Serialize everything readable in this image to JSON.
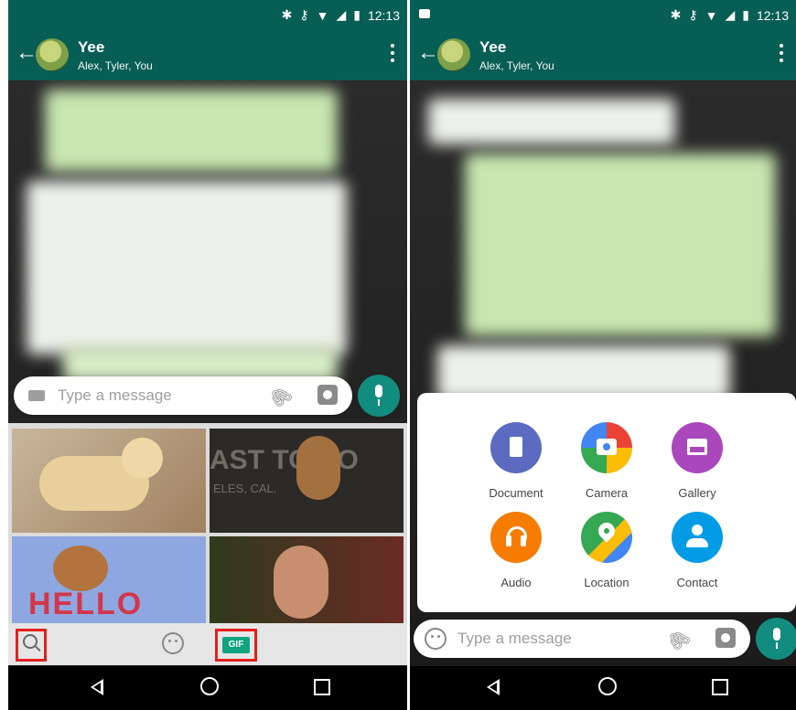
{
  "left": {
    "status": {
      "time": "12:13"
    },
    "header": {
      "title": "Yee",
      "subtitle": "Alex, Tyler, You"
    },
    "input": {
      "placeholder": "Type a message"
    },
    "gif_panel": {
      "gif_badge": "GIF",
      "hello_text": "HELLO",
      "coast_text": "AST TO CO",
      "city_text": "ELES, CAL."
    }
  },
  "right": {
    "status": {
      "time": "12:13"
    },
    "header": {
      "title": "Yee",
      "subtitle": "Alex, Tyler, You"
    },
    "attach_menu": {
      "items": [
        {
          "label": "Document",
          "color": "#5c6bc0"
        },
        {
          "label": "Camera",
          "color": "#ea4335"
        },
        {
          "label": "Gallery",
          "color": "#ab47bc"
        },
        {
          "label": "Audio",
          "color": "#f57c00"
        },
        {
          "label": "Location",
          "color": "#34a853"
        },
        {
          "label": "Contact",
          "color": "#039be5"
        }
      ]
    },
    "input": {
      "placeholder": "Type a message"
    }
  },
  "colors": {
    "whatsapp_dark": "#075e54",
    "accent_green": "#128c7e",
    "highlight_red": "#e3201e"
  },
  "icons": [
    "arrow-left-icon",
    "avatar",
    "kebab-menu-icon",
    "keyboard-icon",
    "paperclip-icon",
    "camera-icon",
    "mic-icon",
    "search-icon",
    "emoji-icon",
    "gif-icon",
    "nav-back-icon",
    "nav-home-icon",
    "nav-recents-icon"
  ]
}
